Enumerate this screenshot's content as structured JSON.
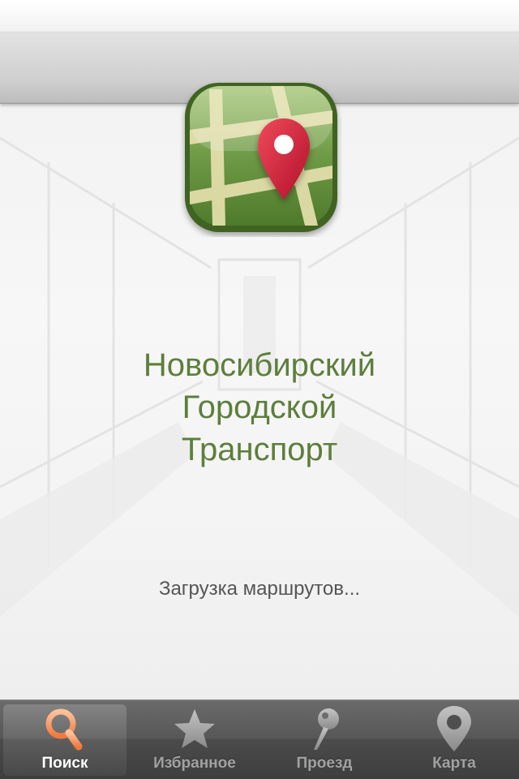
{
  "app": {
    "title_lines": [
      "Новосибирский",
      "Городской",
      "Транспорт"
    ],
    "loading_text": "Загрузка маршрутов...",
    "accent_color": "#5d7e3c",
    "icon": "map-pin-app-icon"
  },
  "tab_bar": {
    "tabs": [
      {
        "label": "Поиск",
        "icon": "search-icon",
        "active": true
      },
      {
        "label": "Избранное",
        "icon": "star-icon",
        "active": false
      },
      {
        "label": "Проезд",
        "icon": "pushpin-icon",
        "active": false
      },
      {
        "label": "Карта",
        "icon": "map-pin-icon",
        "active": false
      }
    ]
  }
}
